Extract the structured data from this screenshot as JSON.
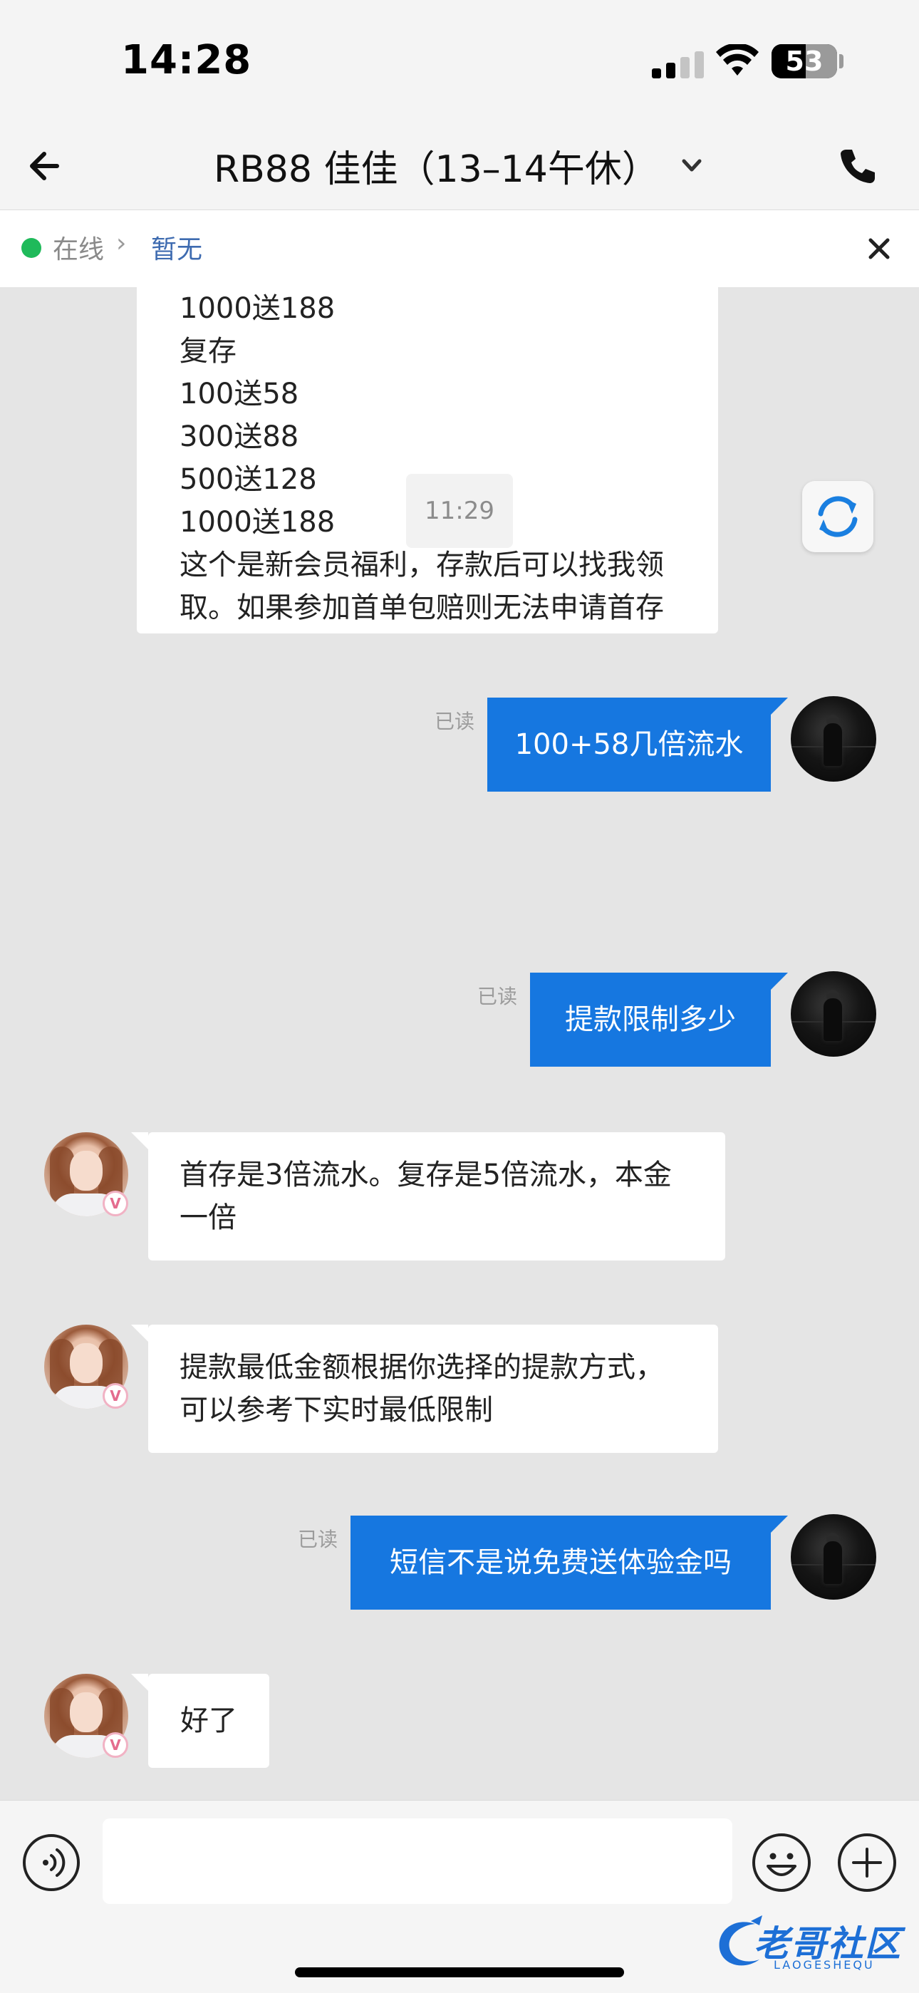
{
  "status_bar": {
    "time": "14:28",
    "battery": "53"
  },
  "header": {
    "title": "RB88 佳佳（13–14午休）",
    "back_icon": "back-arrow-icon",
    "dropdown_icon": "chevron-down-icon",
    "call_icon": "phone-icon"
  },
  "info_bar": {
    "status": "在线",
    "queue": "暂无",
    "status_color": "#1fba5a"
  },
  "messages": {
    "m1": {
      "lines": [
        "1000送188",
        "复存",
        "100送58",
        "300送88",
        "500送128",
        "1000送188",
        "这个是新会员福利，存款后可以找我领",
        "取。如果参加首单包赔则无法申请首存"
      ]
    },
    "m2": {
      "read": "已读",
      "text": "100+58几倍流水"
    },
    "time_divider": "11:29",
    "m3": {
      "read": "已读",
      "text": "提款限制多少"
    },
    "m4": {
      "lines": [
        "首存是3倍流水。复存是5倍流水，本金",
        "一倍"
      ]
    },
    "m5": {
      "lines": [
        "提款最低金额根据你选择的提款方式，",
        "可以参考下实时最低限制"
      ]
    },
    "m6": {
      "read": "已读",
      "text": "短信不是说免费送体验金吗"
    },
    "m7": {
      "text": "好了"
    },
    "badge": "V"
  },
  "input_bar": {
    "placeholder": "",
    "voice_icon": "voice-icon",
    "emoji_icon": "emoji-icon",
    "plus_icon": "plus-icon"
  },
  "watermark": {
    "text": "老哥社区",
    "sub": "LAOGESHEQU"
  },
  "colors": {
    "outgoing_bubble": "#1677e0",
    "incoming_bubble": "#ffffff",
    "chat_background": "#e5e5e5"
  }
}
